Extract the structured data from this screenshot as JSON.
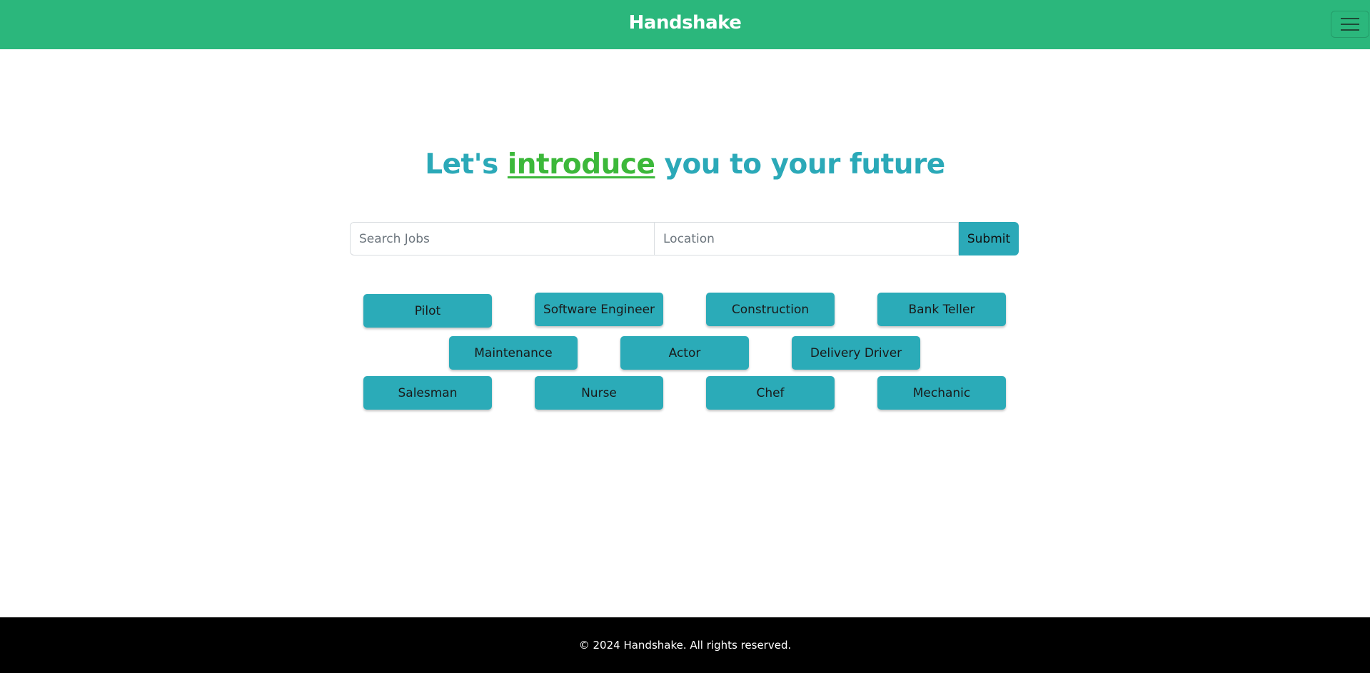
{
  "navbar": {
    "brand": "Handshake",
    "menu_icon": "hamburger-menu-icon",
    "color": "#2bb77c"
  },
  "hero": {
    "prefix": "Let's ",
    "highlight": "introduce",
    "suffix": " you to your future",
    "color": "#2ba9b8",
    "highlight_color": "#3cb83a"
  },
  "search": {
    "jobs_placeholder": "Search Jobs",
    "jobs_value": "",
    "location_placeholder": "Location",
    "location_value": "",
    "submit_label": "Submit"
  },
  "categories": [
    "Pilot",
    "Software Engineer",
    "Construction",
    "Bank Teller",
    "Maintenance",
    "Actor",
    "Delivery Driver",
    "Salesman",
    "Nurse",
    "Chef",
    "Mechanic"
  ],
  "footer": {
    "text": "© 2024 Handshake. All rights reserved."
  }
}
